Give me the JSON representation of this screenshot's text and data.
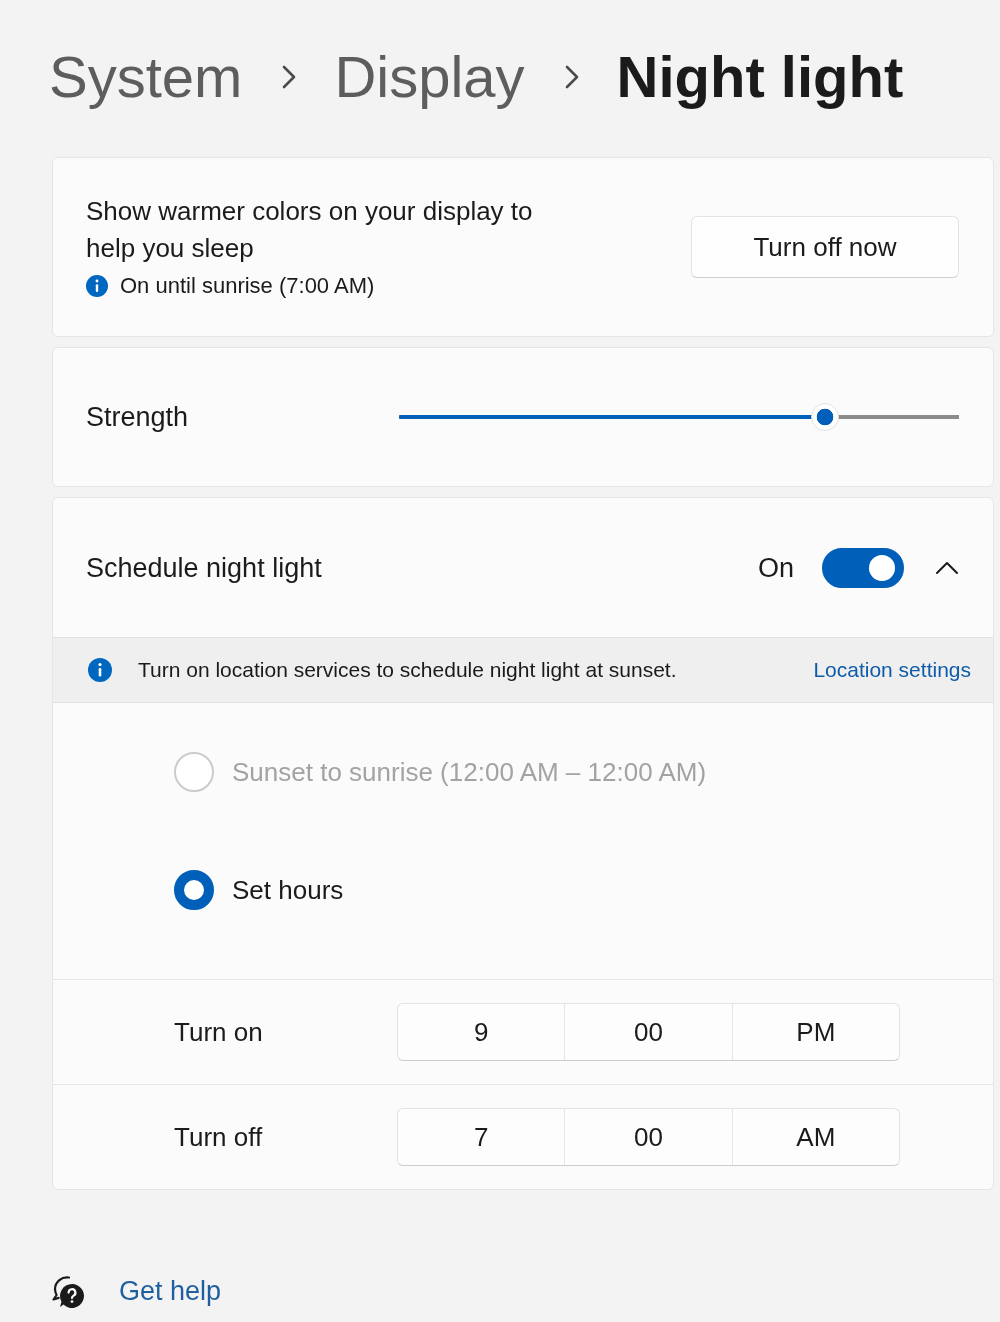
{
  "breadcrumb": [
    {
      "label": "System",
      "current": false
    },
    {
      "label": "Display",
      "current": false
    },
    {
      "label": "Night light",
      "current": true
    }
  ],
  "status_card": {
    "description": "Show warmer colors on your display to help you sleep",
    "status": "On until sunrise (7:00 AM)",
    "button": "Turn off now"
  },
  "strength": {
    "label": "Strength",
    "level": 0.76
  },
  "schedule": {
    "label": "Schedule night light",
    "toggle_label": "On",
    "on": true,
    "expanded": true,
    "notice": {
      "text": "Turn on location services to schedule night light at sunset.",
      "link": "Location settings"
    },
    "options": [
      {
        "label": "Sunset to sunrise (12:00 AM – 12:00 AM)",
        "selected": false,
        "disabled": true
      },
      {
        "label": "Set hours",
        "selected": true,
        "disabled": false
      }
    ],
    "times": [
      {
        "label": "Turn on",
        "hour": "9",
        "minute": "00",
        "period": "PM"
      },
      {
        "label": "Turn off",
        "hour": "7",
        "minute": "00",
        "period": "AM"
      }
    ]
  },
  "help_link": "Get help"
}
